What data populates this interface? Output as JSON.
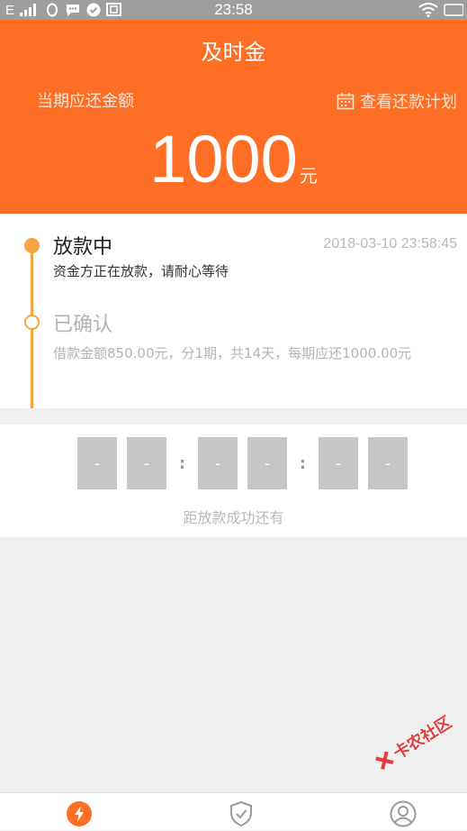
{
  "status_bar": {
    "signal_text": "E",
    "time": "23:58"
  },
  "header": {
    "title": "及时金",
    "due_label": "当期应还金额",
    "plan_link": "查看还款计划",
    "amount": "1000",
    "unit": "元",
    "bg_color": "#ff6e25"
  },
  "timeline": {
    "accent_color": "#f7a441",
    "steps": [
      {
        "title": "放款中",
        "time": "2018-03-10 23:58:45",
        "desc": "资金方正在放款，请耐心等待",
        "state": "active"
      },
      {
        "title": "已确认",
        "desc": "借款金额850.00元，分1期，共14天，每期应还1000.00元",
        "state": "done"
      }
    ]
  },
  "countdown": {
    "digits": [
      "-",
      "-",
      "-",
      "-",
      "-",
      "-"
    ],
    "separator": ":",
    "caption": "距放款成功还有"
  },
  "nav": {
    "items": [
      {
        "icon": "lightning-icon",
        "active": true
      },
      {
        "icon": "shield-check-icon",
        "active": false
      },
      {
        "icon": "user-icon",
        "active": false
      }
    ]
  },
  "watermark": {
    "text": "卡农社区"
  }
}
